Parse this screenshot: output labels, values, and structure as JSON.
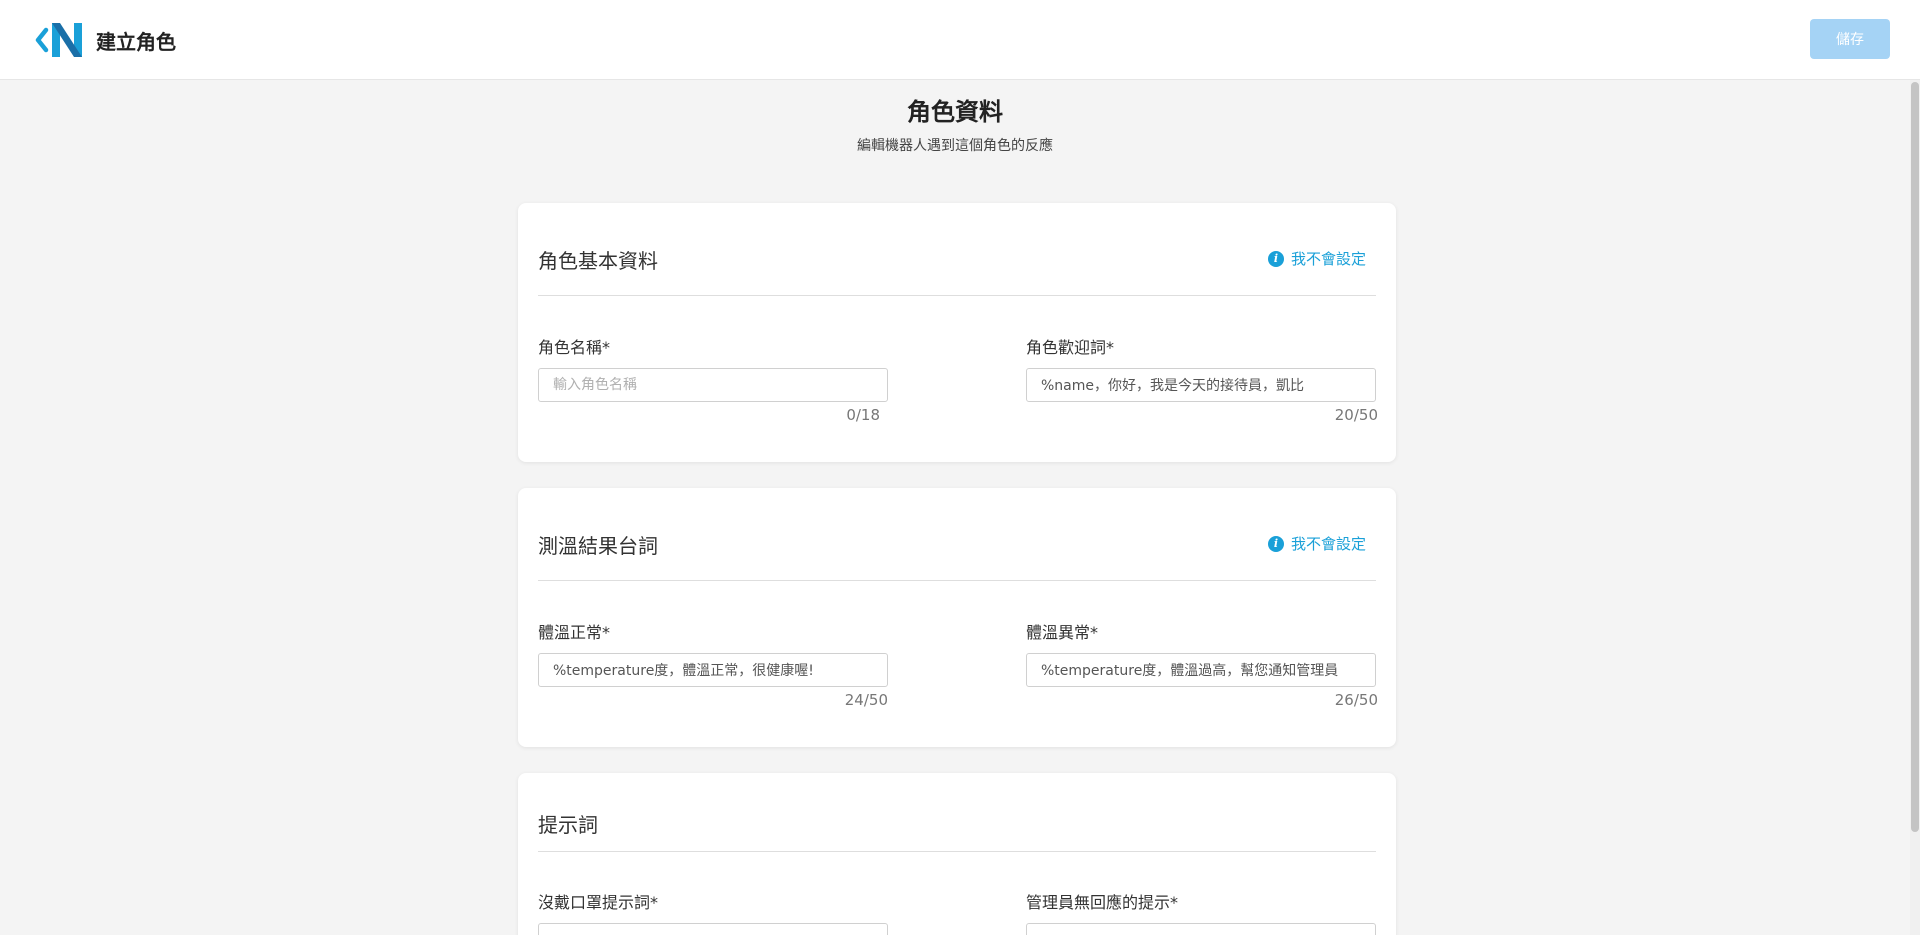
{
  "header": {
    "title": "建立角色",
    "save_label": "儲存"
  },
  "page": {
    "title": "角色資料",
    "subtitle": "編輯機器人遇到這個角色的反應"
  },
  "help_label": "我不會設定",
  "cards": [
    {
      "title": "角色基本資料",
      "fields": [
        {
          "label": "角色名稱*",
          "value": "",
          "placeholder": "輸入角色名稱",
          "counter": "0/18"
        },
        {
          "label": "角色歡迎詞*",
          "value": "%name，你好，我是今天的接待員，凱比",
          "placeholder": "",
          "counter": "20/50"
        }
      ]
    },
    {
      "title": "測溫結果台詞",
      "fields": [
        {
          "label": "體溫正常*",
          "value": "%temperature度，體溫正常，很健康喔!",
          "placeholder": "",
          "counter": "24/50"
        },
        {
          "label": "體溫異常*",
          "value": "%temperature度，體溫過高，幫您通知管理員",
          "placeholder": "",
          "counter": "26/50"
        }
      ]
    },
    {
      "title": "提示詞",
      "fields": [
        {
          "label": "沒戴口罩提示詞*",
          "value": "",
          "placeholder": "",
          "counter": ""
        },
        {
          "label": "管理員無回應的提示*",
          "value": "",
          "placeholder": "",
          "counter": ""
        }
      ]
    }
  ],
  "colors": {
    "accent": "#1aa0d8",
    "save_disabled": "#a5d3f5",
    "background": "#f4f4f4"
  }
}
